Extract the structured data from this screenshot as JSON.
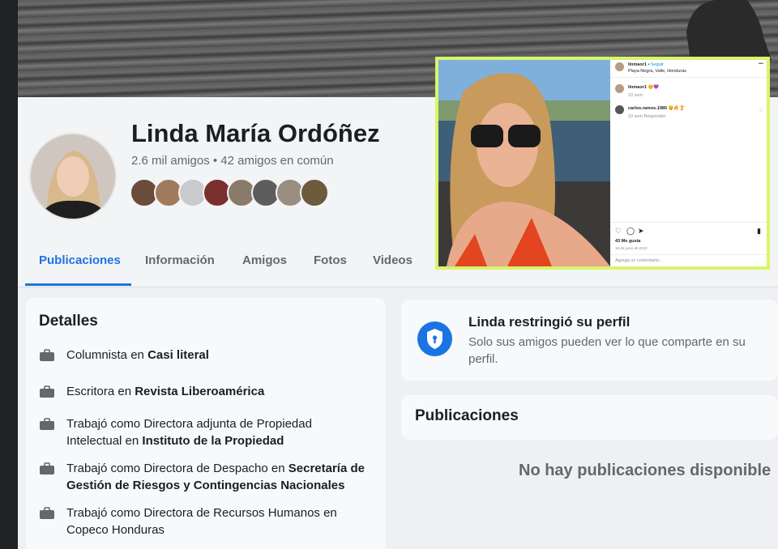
{
  "profile": {
    "name": "Linda María Ordóñez",
    "friends_summary": "2.6 mil amigos • 42 amigos en común"
  },
  "tabs": [
    "Publicaciones",
    "Información",
    "Amigos",
    "Fotos",
    "Videos"
  ],
  "details": {
    "title": "Detalles",
    "items": [
      {
        "prefix": "Columnista en ",
        "bold": "Casi literal",
        "suffix": ""
      },
      {
        "prefix": "Escritora en ",
        "bold": "Revista Liberoamérica",
        "suffix": ""
      },
      {
        "prefix": "Trabajó como Directora adjunta de Propiedad Intelectual en ",
        "bold": "Instituto de la Propiedad",
        "suffix": ""
      },
      {
        "prefix": "Trabajó como Directora de Despacho en ",
        "bold": "Secretaría de Gestión de Riesgos y Contingencias Nacionales",
        "suffix": ""
      },
      {
        "prefix": "Trabajó como Directora de Recursos Humanos en Copeco Honduras",
        "bold": "",
        "suffix": ""
      }
    ]
  },
  "restriction": {
    "title": "Linda restringió su perfil",
    "text": "Solo sus amigos pueden ver lo que comparte en su perfil."
  },
  "posts": {
    "title": "Publicaciones",
    "empty": "No hay publicaciones disponible"
  },
  "instagram": {
    "username": "linmaor1",
    "follow": "Seguir",
    "location": "Playa Negra, Valle, Honduras",
    "caption_user": "linmaor1",
    "caption_time": "10 sem",
    "comment_user": "carlos.ramos.1985",
    "comment_time": "10 sem",
    "reply": "Responder",
    "likes": "43 Me gusta",
    "date": "15 de junio de 2023",
    "add_comment": "Agrega un comentario..."
  },
  "colors": {
    "accent": "#1b74e4",
    "inset_border": "#d8f56b"
  }
}
